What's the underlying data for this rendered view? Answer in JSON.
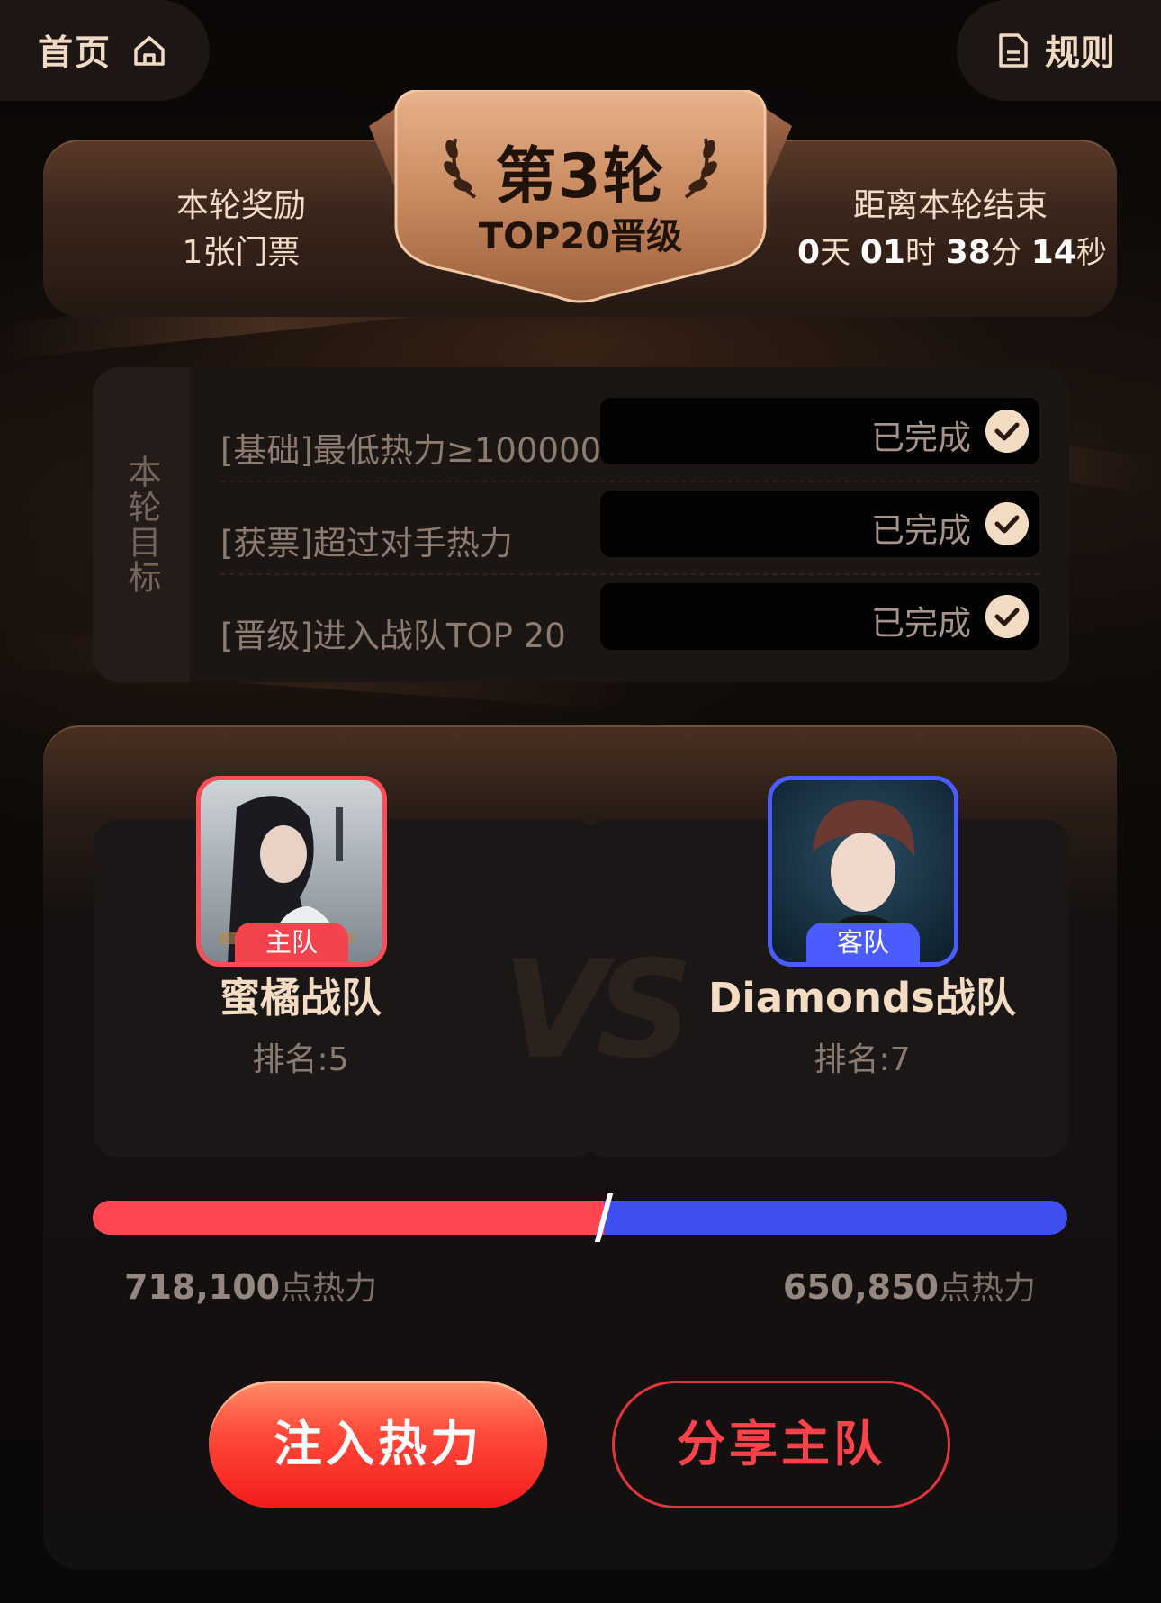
{
  "topbar": {
    "home_label": "首页",
    "rules_label": "规则"
  },
  "round": {
    "title": "第3轮",
    "subtitle": "TOP20晋级",
    "reward_label": "本轮奖励",
    "reward_value": "1张门票",
    "countdown_label": "距离本轮结束",
    "countdown": {
      "days": "0",
      "days_unit": "天",
      "hours": "01",
      "hours_unit": "时",
      "minutes": "38",
      "minutes_unit": "分",
      "seconds": "14",
      "seconds_unit": "秒"
    }
  },
  "goals": {
    "side_label": "本轮目标",
    "items": [
      {
        "label": "[基础]最低热力≥100000",
        "status": "已完成"
      },
      {
        "label": "[获票]超过对手热力",
        "status": "已完成"
      },
      {
        "label": "[晋级]进入战队TOP 20",
        "status": "已完成"
      }
    ]
  },
  "battle": {
    "home": {
      "tag": "主队",
      "name": "蜜橘战队",
      "rank": "排名:5",
      "heat_value": "718,100",
      "heat_unit": "点热力"
    },
    "away": {
      "tag": "客队",
      "name": "Diamonds战队",
      "rank": "排名:7",
      "heat_value": "650,850",
      "heat_unit": "点热力"
    },
    "vs_label": "VS",
    "home_share": 0.5245,
    "inject_button": "注入热力",
    "share_button": "分享主队"
  },
  "colors": {
    "home": "#fd4650",
    "away": "#4050ee",
    "accent": "#f4dcc4"
  }
}
